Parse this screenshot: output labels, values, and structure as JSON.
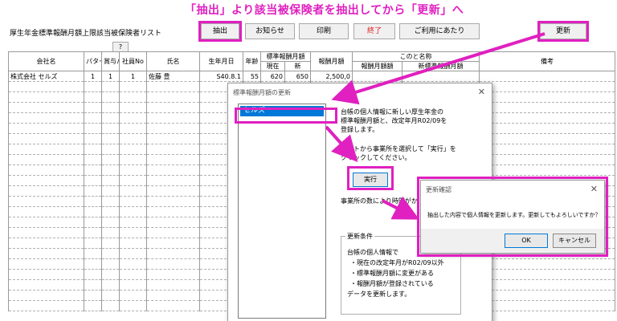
{
  "annotation": "「抽出」より該当被保険者を抽出してから「更新」へ",
  "list_title": "厚生年金標準報酬月額上限該当被保険者リスト",
  "toolbar": {
    "extract": "抽出",
    "notice": "お知らせ",
    "print": "印刷",
    "quit": "終了",
    "help": "ご利用にあたり",
    "update": "更新",
    "question": "?"
  },
  "table": {
    "headers": {
      "company": "会社名",
      "pattern_std": "パターン科目",
      "pattern_bonus": "賞与パターン",
      "employee_no": "社員No",
      "name": "氏名",
      "birth": "生年月日",
      "age": "年齢",
      "std_monthly": "標準報酬月額",
      "current": "現在",
      "new": "新",
      "remuneration": "報酬月額",
      "change_target": "このと名称",
      "remuneration_amount": "報酬月額額",
      "new_std_monthly": "新標準報酬月額",
      "remarks": "備考"
    },
    "rows": [
      {
        "company": "株式会社 セルズ",
        "pattern_std": "1",
        "pattern_bonus": "1",
        "employee_no": "1",
        "name": "佐藤 豊",
        "birth": "S40.8.1",
        "age": "55",
        "current": "620",
        "new": "650",
        "remuneration": "2,500,0"
      }
    ]
  },
  "dialog_update": {
    "title": "標準報酬月額の更新",
    "list_item": "セルズ",
    "info_line1": "台帳の個人情報に新しい厚生年金の",
    "info_line2": "標準報酬月額と、改定年月R02/09を",
    "info_line3": "登録します。",
    "instr_line1": "リストから事業所を選択して「実行」を",
    "instr_line2": "クリックしてください。",
    "run_button": "実行",
    "time_note": "事業所の数により時間がか",
    "cond_legend": "更新条件",
    "cond_line1": "台帳の個人情報で",
    "cond_line2": "・現在の改定年月がR02/09以外",
    "cond_line3": "・標準報酬月額に変更がある",
    "cond_line4": "・報酬月額が登録されている",
    "cond_line5": "データを更新します。"
  },
  "dialog_confirm": {
    "title": "更新確認",
    "message": "抽出した内容で個人情報を更新します。更新してもよろしいですか？",
    "ok": "OK",
    "cancel": "キャンセル"
  },
  "colors": {
    "accent": "#e020c0",
    "selection": "#0078d7",
    "quit_text": "#e02020"
  },
  "icons": {
    "close": "close-icon",
    "question": "question-icon"
  }
}
